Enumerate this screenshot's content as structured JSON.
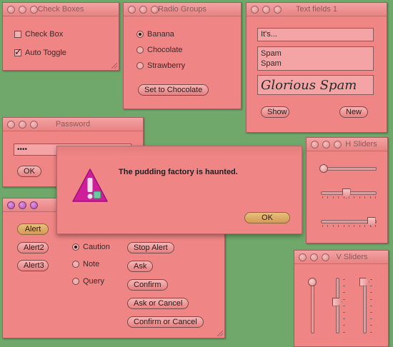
{
  "windows": {
    "check_boxes": {
      "title": "Check Boxes",
      "items": [
        {
          "label": "Check Box",
          "checked": false
        },
        {
          "label": "Auto Toggle",
          "checked": true
        }
      ]
    },
    "radio_groups": {
      "title": "Radio Groups",
      "options": [
        {
          "label": "Banana",
          "selected": true
        },
        {
          "label": "Chocolate",
          "selected": false
        },
        {
          "label": "Strawberry",
          "selected": false
        }
      ],
      "button": "Set to Chocolate"
    },
    "text_fields": {
      "title": "Text fields 1",
      "field1": "It's...",
      "field2_lines": [
        "Spam",
        "Spam"
      ],
      "field3": "Glorious Spam",
      "show_button": "Show",
      "new_button": "New"
    },
    "password": {
      "title": "Password",
      "value": "••••",
      "ok_button": "OK"
    },
    "h_sliders": {
      "title": "H Sliders",
      "values": [
        0,
        0.45,
        0.95
      ]
    },
    "v_sliders": {
      "title": "V Sliders",
      "values": [
        0.05,
        0.45,
        0.05
      ]
    },
    "alerts": {
      "buttons_left": [
        "Alert",
        "Alert2",
        "Alert3"
      ],
      "radios": [
        {
          "label": "Caution",
          "selected": true
        },
        {
          "label": "Note",
          "selected": false
        },
        {
          "label": "Query",
          "selected": false
        }
      ],
      "buttons_right": [
        "Stop Alert",
        "Ask",
        "Confirm",
        "Ask or Cancel",
        "Confirm or Cancel"
      ]
    }
  },
  "dialog": {
    "message": "The pudding factory is haunted.",
    "ok_button": "OK",
    "icon": "caution-icon"
  },
  "colors": {
    "background": "#6fa86a",
    "window": "#ef8585",
    "dialog_icon": "#d11f9a"
  }
}
